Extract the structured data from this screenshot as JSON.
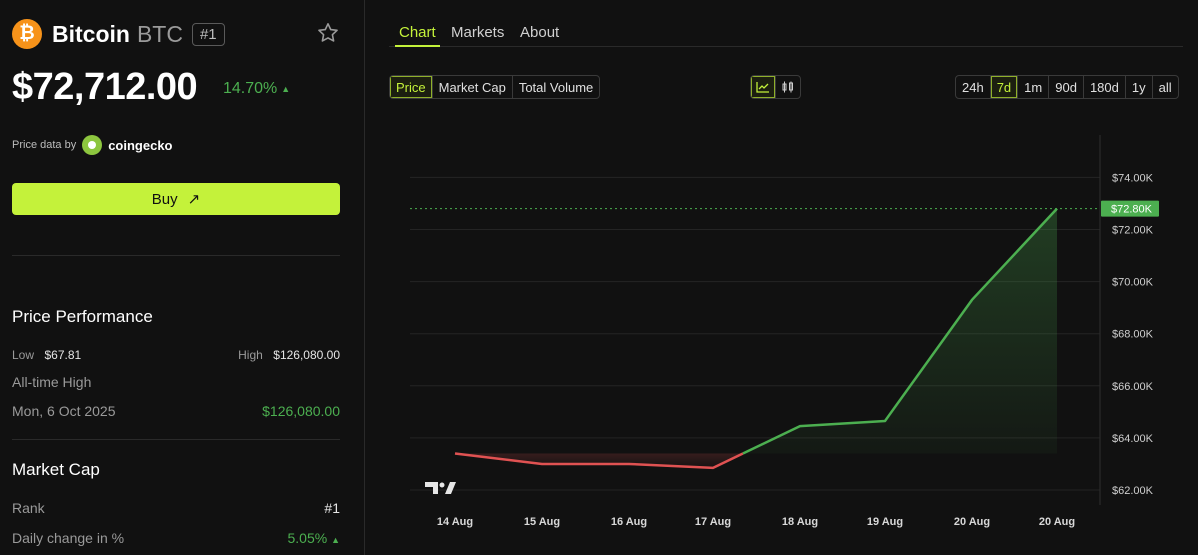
{
  "coin": {
    "name": "Bitcoin",
    "symbol": "BTC",
    "rank_badge": "#1"
  },
  "price": "$72,712.00",
  "change": {
    "pct": "14.70%",
    "arrow": "▲"
  },
  "price_data": {
    "label": "Price data by",
    "provider": "coingecko"
  },
  "buy": {
    "label": "Buy",
    "icon": "↗"
  },
  "performance": {
    "title": "Price Performance",
    "low_label": "Low",
    "low_value": "$67.81",
    "high_label": "High",
    "high_value": "$126,080.00",
    "ath_label": "All-time High",
    "ath_date": "Mon, 6 Oct 2025",
    "ath_value": "$126,080.00"
  },
  "market_cap": {
    "title": "Market Cap",
    "rank_label": "Rank",
    "rank_value": "#1",
    "daily_label": "Daily change in %",
    "daily_value": "5.05%",
    "daily_arrow": "▲"
  },
  "tabs": [
    "Chart",
    "Markets",
    "About"
  ],
  "metric_toggle": [
    "Price",
    "Market Cap",
    "Total Volume"
  ],
  "ranges": [
    "24h",
    "7d",
    "1m",
    "90d",
    "180d",
    "1y",
    "all"
  ],
  "colors": {
    "accent": "#c4f23a",
    "up": "#4caf50",
    "down": "#e05252",
    "background": "#111111"
  },
  "chart_data": {
    "type": "line",
    "x": [
      "14 Aug",
      "15 Aug",
      "16 Aug",
      "17 Aug",
      "18 Aug",
      "19 Aug",
      "20 Aug",
      "20 Aug"
    ],
    "series": [
      {
        "values": [
          63400,
          63000,
          63000,
          62850,
          64450,
          64650,
          69300,
          72800
        ]
      }
    ],
    "y_ticks": [
      "$62.00K",
      "$64.00K",
      "$66.00K",
      "$68.00K",
      "$70.00K",
      "$72.00K",
      "$74.00K"
    ],
    "current_label": "$72.80K",
    "ylim": [
      61500,
      75500
    ],
    "grid": true,
    "watermark": "TV"
  }
}
